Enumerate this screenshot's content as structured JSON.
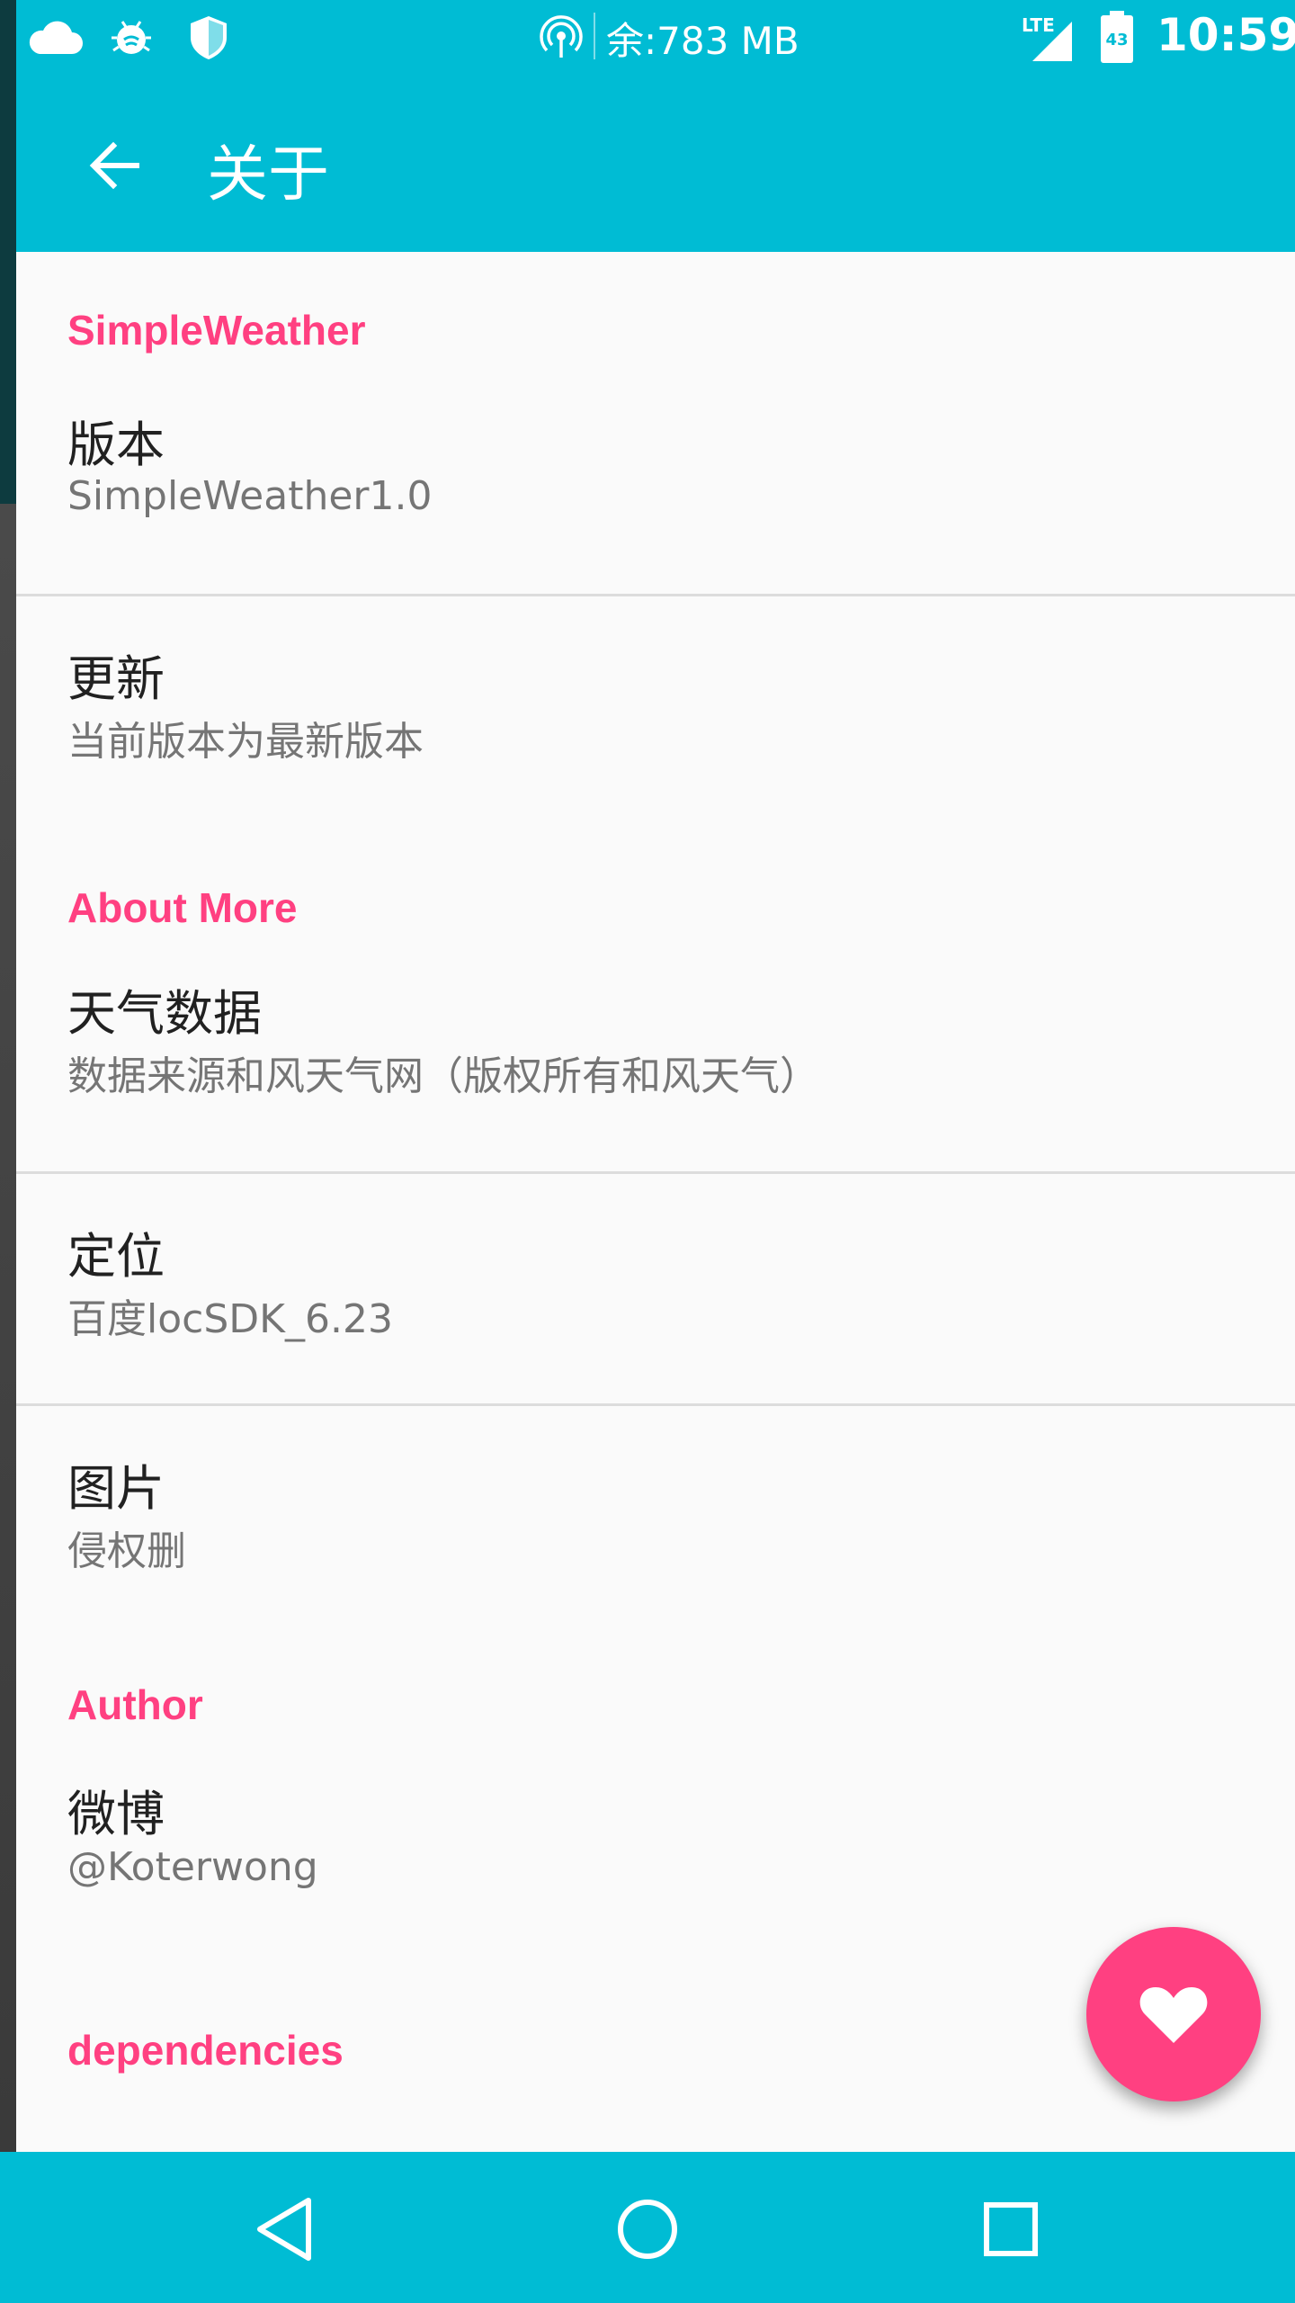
{
  "status_bar": {
    "memory": "余:783 MB",
    "network": "LTE",
    "battery": "43",
    "time": "10:59"
  },
  "app_bar": {
    "title": "关于"
  },
  "sections": {
    "simpleweather": {
      "header": "SimpleWeather",
      "version_title": "版本",
      "version_value": "SimpleWeather1.0",
      "update_title": "更新",
      "update_value": "当前版本为最新版本"
    },
    "about_more": {
      "header": "About More",
      "weather_title": "天气数据",
      "weather_value": "数据来源和风天气网（版权所有和风天气）",
      "location_title": "定位",
      "location_value": "百度locSDK_6.23",
      "image_title": "图片",
      "image_value": "侵权删"
    },
    "author": {
      "header": "Author",
      "weibo_title": "微博",
      "weibo_value": "@Koterwong"
    },
    "dependencies": {
      "header": "dependencies"
    }
  },
  "colors": {
    "primary": "#00bcd4",
    "accent": "#ff4081",
    "background": "#fafafa",
    "title_text": "#212121",
    "summary_text": "#757575"
  },
  "icons": {
    "status_bar": [
      "cloud-icon",
      "bug-icon",
      "shield-icon",
      "hotspot-icon",
      "signal-icon",
      "battery-icon"
    ],
    "app_bar": [
      "back-arrow-icon"
    ],
    "fab": "heart-icon",
    "nav_bar": [
      "nav-back-icon",
      "nav-home-icon",
      "nav-recents-icon"
    ]
  }
}
